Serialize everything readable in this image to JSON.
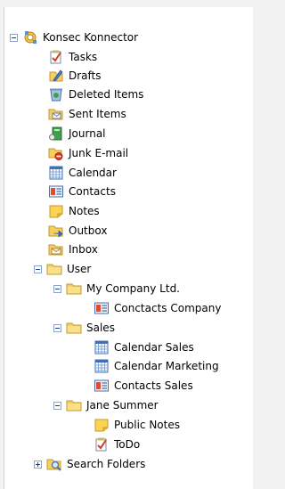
{
  "tree": {
    "root": {
      "label": "Konsec Konnector",
      "icon": "mailbox-root-icon",
      "expanded": true
    },
    "items": [
      {
        "label": "Tasks",
        "icon": "tasks-icon"
      },
      {
        "label": "Drafts",
        "icon": "drafts-icon"
      },
      {
        "label": "Deleted Items",
        "icon": "deleted-items-icon"
      },
      {
        "label": "Sent Items",
        "icon": "sent-items-icon"
      },
      {
        "label": "Journal",
        "icon": "journal-icon"
      },
      {
        "label": "Junk E-mail",
        "icon": "junk-email-icon"
      },
      {
        "label": "Calendar",
        "icon": "calendar-icon"
      },
      {
        "label": "Contacts",
        "icon": "contacts-icon"
      },
      {
        "label": "Notes",
        "icon": "notes-icon"
      },
      {
        "label": "Outbox",
        "icon": "outbox-icon"
      },
      {
        "label": "Inbox",
        "icon": "inbox-icon"
      }
    ],
    "user": {
      "label": "User",
      "icon": "folder-icon",
      "expanded": true,
      "my_company": {
        "label": "My Company Ltd.",
        "expanded": true,
        "children": [
          {
            "label": "Conctacts Company",
            "icon": "contacts-icon"
          }
        ]
      },
      "sales": {
        "label": "Sales",
        "expanded": true,
        "children": [
          {
            "label": "Calendar Sales",
            "icon": "calendar-icon"
          },
          {
            "label": "Calendar Marketing",
            "icon": "calendar-icon"
          },
          {
            "label": "Contacts Sales",
            "icon": "contacts-icon"
          }
        ]
      },
      "jane": {
        "label": "Jane Summer",
        "expanded": true,
        "children": [
          {
            "label": "Public Notes",
            "icon": "notes-icon"
          },
          {
            "label": "ToDo",
            "icon": "tasks-icon"
          }
        ]
      }
    },
    "search_folders": {
      "label": "Search Folders",
      "icon": "search-folder-icon",
      "expanded": false
    }
  }
}
